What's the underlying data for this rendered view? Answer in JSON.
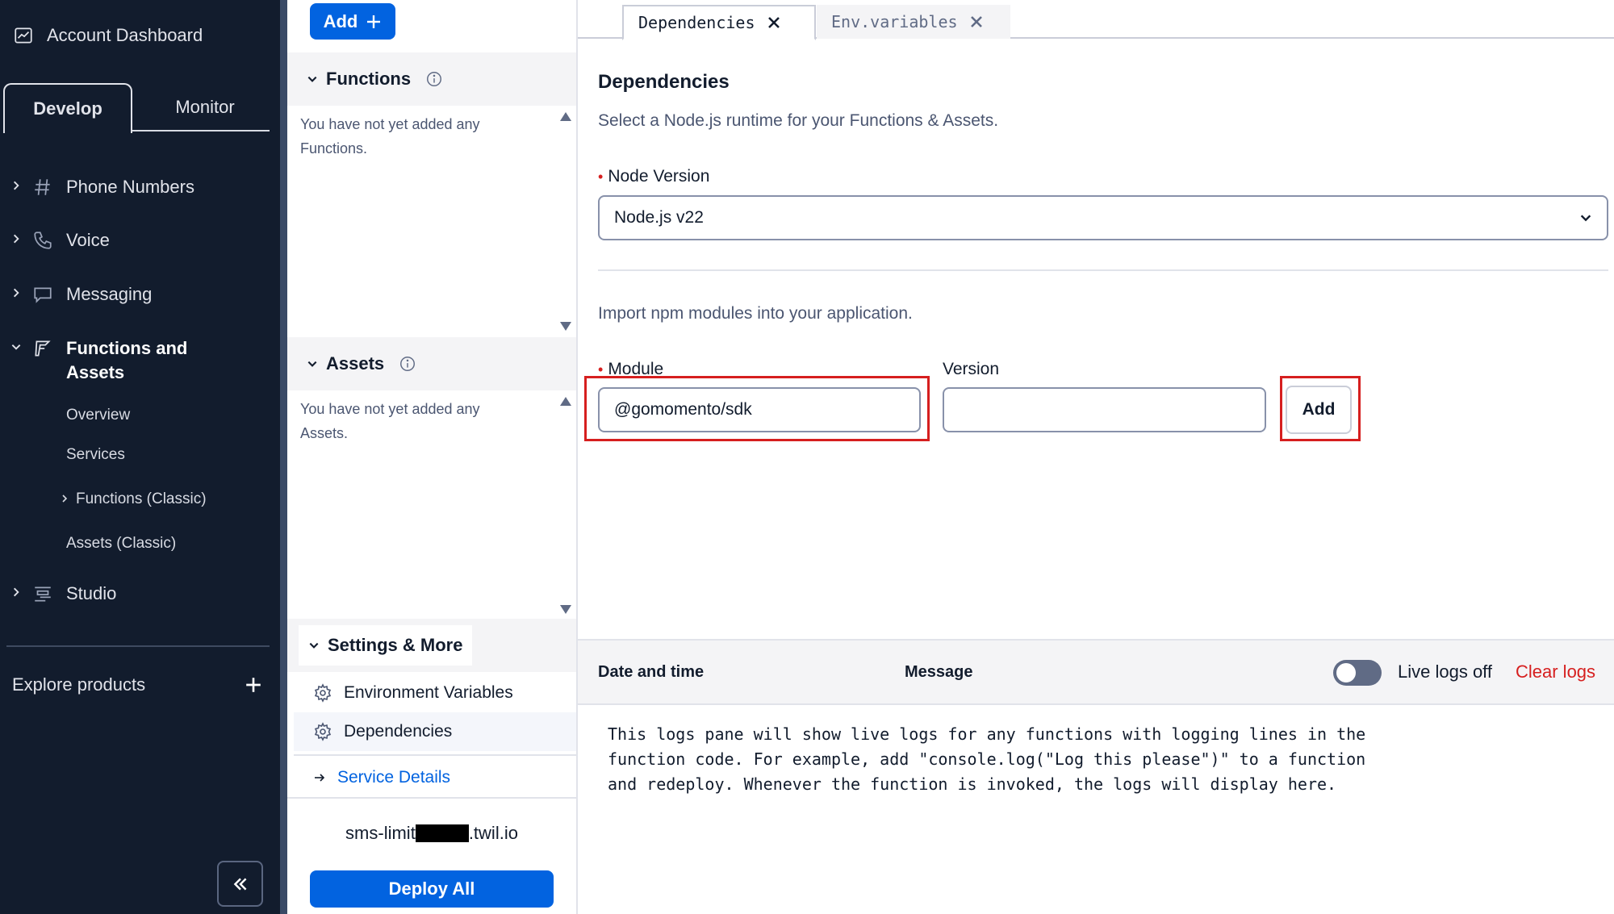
{
  "sidebar": {
    "account_label": "Account Dashboard",
    "tabs": [
      {
        "label": "Develop",
        "active": true
      },
      {
        "label": "Monitor",
        "active": false
      }
    ],
    "nav": [
      {
        "label": "Phone Numbers",
        "icon": "hash-icon"
      },
      {
        "label": "Voice",
        "icon": "phone-icon"
      },
      {
        "label": "Messaging",
        "icon": "chat-icon"
      },
      {
        "label": "Functions and Assets",
        "icon": "functions-icon",
        "expanded": true
      },
      {
        "label": "Studio",
        "icon": "studio-icon"
      }
    ],
    "sub_items": [
      "Overview",
      "Services",
      "Functions (Classic)",
      "Assets (Classic)"
    ],
    "explore_label": "Explore products"
  },
  "middle": {
    "add_label": "Add",
    "functions": {
      "title": "Functions",
      "empty": "You have not yet added any Functions."
    },
    "assets": {
      "title": "Assets",
      "empty": "You have not yet added any Assets."
    },
    "settings": {
      "title": "Settings & More",
      "items": [
        "Environment Variables",
        "Dependencies"
      ],
      "link": "Service Details"
    },
    "domain_prefix": "sms-limit",
    "domain_suffix": ".twil.io",
    "deploy_label": "Deploy All"
  },
  "editor": {
    "tabs": [
      {
        "label": "Dependencies",
        "active": true
      },
      {
        "label": "Env.variables",
        "active": false
      }
    ],
    "title": "Dependencies",
    "subtitle": "Select a Node.js runtime for your Functions & Assets.",
    "node_label": "Node Version",
    "node_value": "Node.js v22",
    "npm_subtitle": "Import npm modules into your application.",
    "module_label": "Module",
    "module_value": "@gomomento/sdk",
    "version_label": "Version",
    "version_value": "",
    "add_label": "Add"
  },
  "logs": {
    "col_date": "Date and time",
    "col_message": "Message",
    "live_label": "Live logs off",
    "live_on": false,
    "clear_label": "Clear logs",
    "body": "This logs pane will show live logs for any functions with logging lines in the\nfunction code. For example, add \"console.log(\"Log this please\")\" to a function\nand redeploy. Whenever the function is invoked, the logs will display here."
  },
  "colors": {
    "sidebar_bg": "#121c2d",
    "primary": "#0263e0",
    "error": "#d61f1f"
  }
}
